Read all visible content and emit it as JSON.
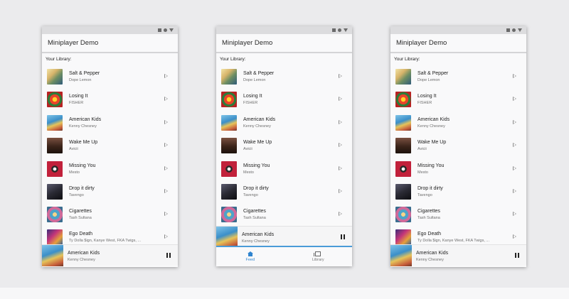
{
  "app_title": "Miniplayer Demo",
  "section_label": "Your Library:",
  "tracks": [
    {
      "title": "Salt & Pepper",
      "artist": "Dope Lemon"
    },
    {
      "title": "Losing It",
      "artist": "FISHER"
    },
    {
      "title": "American Kids",
      "artist": "Kenny Chesney"
    },
    {
      "title": "Wake Me Up",
      "artist": "Avicii"
    },
    {
      "title": "Missing You",
      "artist": "Mesto"
    },
    {
      "title": "Drop it dirty",
      "artist": "Tavengo"
    },
    {
      "title": "Cigarettes",
      "artist": "Tash Sultana"
    },
    {
      "title": "Ego Death",
      "artist": "Ty Dolla $ign, Kanye West, FKA Twigs, ..."
    }
  ],
  "now_playing": {
    "title": "American Kids",
    "artist": "Kenny Chesney"
  },
  "nav": {
    "feed_label": "Feed",
    "library_label": "Library"
  },
  "colors": {
    "accent": "#2f84cf",
    "progress": "#4a9bd8",
    "background": "#ebebed"
  },
  "icons": {
    "status": [
      "square-icon",
      "circle-icon",
      "triangle-icon"
    ],
    "play": "play-icon",
    "pause": "pause-icon",
    "feed": "home-icon",
    "library": "library-icon"
  }
}
